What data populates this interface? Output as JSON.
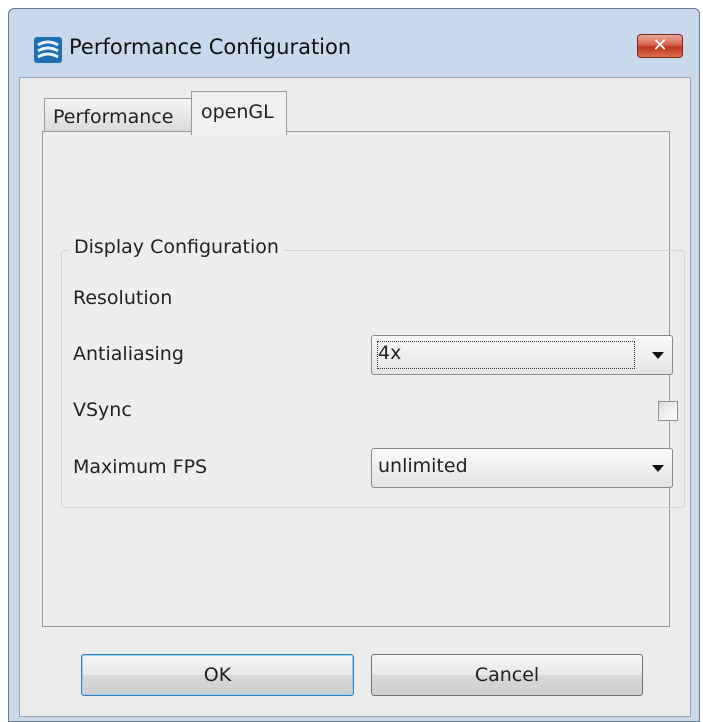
{
  "window": {
    "title": "Performance Configuration",
    "close_glyph": "✕",
    "icon": "app-icon"
  },
  "tabs": [
    {
      "label": "Performance",
      "active": false
    },
    {
      "label": "openGL",
      "active": true
    }
  ],
  "display_config": {
    "group_title": "Display Configuration",
    "resolution_label": "Resolution",
    "antialiasing_label": "Antialiasing",
    "antialiasing_value": "4x",
    "vsync_label": "VSync",
    "vsync_checked": false,
    "max_fps_label": "Maximum FPS",
    "max_fps_value": "unlimited"
  },
  "buttons": {
    "ok": "OK",
    "cancel": "Cancel"
  },
  "colors": {
    "frame": "#c9d8ea",
    "close_button": "#c2351d",
    "ok_focus": "#3c7fb1"
  }
}
